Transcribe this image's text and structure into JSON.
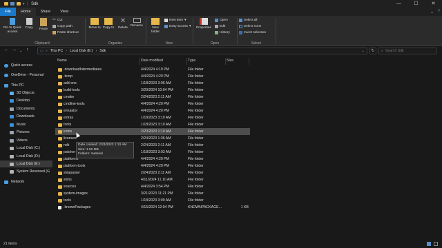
{
  "window": {
    "title": "Sdk",
    "controls": [
      "—",
      "☐",
      "✕"
    ]
  },
  "ribbon_tabs": [
    "File",
    "Home",
    "Share",
    "View"
  ],
  "ribbon": {
    "clipboard": {
      "label": "Clipboard",
      "pin": "Pin to Quick access",
      "copy": "Copy",
      "paste": "Paste",
      "cut": "Cut",
      "copy_path": "Copy path",
      "paste_shortcut": "Paste shortcut"
    },
    "organize": {
      "label": "Organize",
      "move_to": "Move to",
      "copy_to": "Copy to",
      "delete": "Delete",
      "rename": "Rename"
    },
    "new": {
      "label": "New",
      "new_folder": "New folder",
      "new_item": "New item",
      "easy_access": "Easy access"
    },
    "open": {
      "label": "Open",
      "properties": "Properties",
      "open": "Open",
      "edit": "Edit",
      "history": "History"
    },
    "select": {
      "label": "Select",
      "select_all": "Select all",
      "select_none": "Select none",
      "invert": "Invert selection"
    }
  },
  "address": {
    "crumbs": [
      "This PC",
      "Local Disk (E:)",
      "Sdk"
    ],
    "search_placeholder": "Search Sdk"
  },
  "sidebar": [
    {
      "label": "Quick access",
      "icon": "star-icon",
      "color": "#4a9ee0"
    },
    {
      "label": "OneDrive - Personal",
      "icon": "cloud-icon",
      "color": "#4a9ee0"
    },
    {
      "label": "This PC",
      "icon": "computer-icon",
      "color": "#4a9ee0"
    },
    {
      "label": "3D Objects",
      "icon": "cube-icon",
      "color": "#5fb0e6"
    },
    {
      "label": "Desktop",
      "icon": "desktop-icon",
      "color": "#3c8fd8"
    },
    {
      "label": "Documents",
      "icon": "documents-icon",
      "color": "#9aa4b0"
    },
    {
      "label": "Downloads",
      "icon": "download-icon",
      "color": "#3c8fd8"
    },
    {
      "label": "Music",
      "icon": "music-icon",
      "color": "#3c8fd8"
    },
    {
      "label": "Pictures",
      "icon": "pictures-icon",
      "color": "#9aa4b0"
    },
    {
      "label": "Videos",
      "icon": "videos-icon",
      "color": "#9aa4b0"
    },
    {
      "label": "Local Disk (C:)",
      "icon": "drive-icon",
      "color": "#b5b5b5"
    },
    {
      "label": "Local Disk (D:)",
      "icon": "drive-icon",
      "color": "#b5b5b5"
    },
    {
      "label": "Local Disk (E:)",
      "icon": "drive-icon",
      "color": "#b5b5b5"
    },
    {
      "label": "System Reserved (G",
      "icon": "drive-icon",
      "color": "#b5b5b5"
    },
    {
      "label": "Network",
      "icon": "network-icon",
      "color": "#4a9ee0"
    }
  ],
  "columns": {
    "name": "Name",
    "date": "Date modified",
    "type": "Type",
    "size": "Size"
  },
  "files": [
    {
      "name": ".downloadIntermediates",
      "date": "4/4/2024 4:19 PM",
      "type": "File folder",
      "size": ""
    },
    {
      "name": ".temp",
      "date": "4/4/2024 4:20 PM",
      "type": "File folder",
      "size": ""
    },
    {
      "name": "add-ons",
      "date": "1/18/2023 3:06 AM",
      "type": "File folder",
      "size": ""
    },
    {
      "name": "build-tools",
      "date": "3/29/2024 10:04 PM",
      "type": "File folder",
      "size": ""
    },
    {
      "name": "cmake",
      "date": "2/24/2023 2:11 AM",
      "type": "File folder",
      "size": ""
    },
    {
      "name": "cmdline-tools",
      "date": "4/4/2024 4:20 PM",
      "type": "File folder",
      "size": ""
    },
    {
      "name": "emulator",
      "date": "4/4/2024 4:20 PM",
      "type": "File folder",
      "size": ""
    },
    {
      "name": "extras",
      "date": "1/18/2023 3:10 AM",
      "type": "File folder",
      "size": ""
    },
    {
      "name": "fonts",
      "date": "1/18/2023 3:10 AM",
      "type": "File folder",
      "size": ""
    },
    {
      "name": "icons",
      "date": "2/23/2023 1:10 AM",
      "type": "File folder",
      "size": ""
    },
    {
      "name": "licenses",
      "date": "2/24/2023 1:36 AM",
      "type": "File folder",
      "size": ""
    },
    {
      "name": "ndk",
      "date": "2/24/2023 2:11 AM",
      "type": "File folder",
      "size": ""
    },
    {
      "name": "patcher",
      "date": "1/18/2023 3:03 AM",
      "type": "File folder",
      "size": ""
    },
    {
      "name": "platforms",
      "date": "4/4/2024 4:20 PM",
      "type": "File folder",
      "size": ""
    },
    {
      "name": "platform-tools",
      "date": "4/4/2024 4:20 PM",
      "type": "File folder",
      "size": ""
    },
    {
      "name": "skiaparser",
      "date": "2/24/2023 2:11 AM",
      "type": "File folder",
      "size": ""
    },
    {
      "name": "skins",
      "date": "4/11/2024 11:10 AM",
      "type": "File folder",
      "size": ""
    },
    {
      "name": "sources",
      "date": "4/4/2024 3:54 PM",
      "type": "File folder",
      "size": ""
    },
    {
      "name": "system-images",
      "date": "3/21/2023 11:21 PM",
      "type": "File folder",
      "size": ""
    },
    {
      "name": "tools",
      "date": "1/18/2023 3:09 AM",
      "type": "File folder",
      "size": ""
    },
    {
      "name": ".knownPackages",
      "date": "4/15/2024 12:04 PM",
      "type": "KNOWNPACKAGE...",
      "size": "1 KB"
    }
  ],
  "tooltip": {
    "line1": "Date created: 2/23/2023 1:10 AM",
    "line2": "Size: 1.52 MB",
    "line3": "Folders: material"
  },
  "status": {
    "count": "21 items"
  }
}
